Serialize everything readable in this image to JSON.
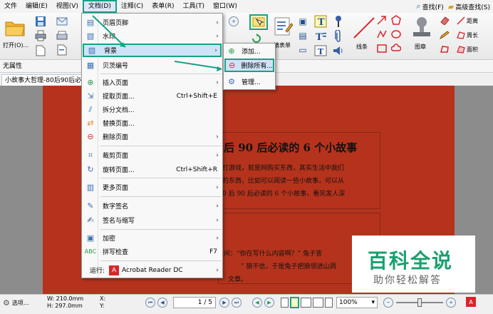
{
  "menubar": {
    "items": [
      "文件",
      "编辑(E)",
      "视图(V)",
      "文档(D)",
      "注释(C)",
      "表单(R)",
      "工具(T)",
      "窗口(W)"
    ],
    "search": "查找(F)",
    "advanced_search": "高级查找(S)"
  },
  "ribbon": {
    "open_label": "打开(O)...",
    "line_label": "线条",
    "stamp_label": "图章",
    "fill_form_label": "填表单",
    "distance_label": "距离",
    "perimeter_label": "周长",
    "area_label": "面积"
  },
  "propbar": {
    "label": "无属性"
  },
  "tab": {
    "label": "小故事大哲理-80后90后必读..."
  },
  "document": {
    "title": "后 90 后必读的 6 个小故事",
    "lines": [
      "打游戏，就是网购买东西，其实生活中我们",
      "的东西，比如可以阅读一些小故事，可以从",
      "0 后 90 后必读的 6 个小故事，看完发人深"
    ],
    "lines2": [
      "问：“你在写什么内容啊？” 兔子答",
      "” 狼不信，于是兔子把狼领进山洞",
      "文章。"
    ]
  },
  "watermark": {
    "title": "百科全说",
    "subtitle": "助你轻松解答"
  },
  "doc_menu": {
    "items": [
      {
        "label": "页眉页脚",
        "shortcut": "",
        "arrow": "›"
      },
      {
        "label": "水印",
        "shortcut": "",
        "arrow": "›"
      },
      {
        "label": "背景",
        "shortcut": "",
        "arrow": "›"
      },
      {
        "label": "贝茨编号",
        "shortcut": "",
        "arrow": ""
      },
      {
        "label": "插入页面",
        "shortcut": "",
        "arrow": "›"
      },
      {
        "label": "提取页面...",
        "shortcut": "Ctrl+Shift+E",
        "arrow": ""
      },
      {
        "label": "拆分文档...",
        "shortcut": "",
        "arrow": ""
      },
      {
        "label": "替换页面...",
        "shortcut": "",
        "arrow": ""
      },
      {
        "label": "删除页面",
        "shortcut": "",
        "arrow": "›"
      },
      {
        "label": "裁剪页面",
        "shortcut": "",
        "arrow": "›"
      },
      {
        "label": "旋转页面...",
        "shortcut": "Ctrl+Shift+R",
        "arrow": ""
      },
      {
        "label": "更多页面",
        "shortcut": "",
        "arrow": "›"
      },
      {
        "label": "数字签名",
        "shortcut": "",
        "arrow": "›"
      },
      {
        "label": "签名与缩写",
        "shortcut": "",
        "arrow": "›"
      },
      {
        "label": "加密",
        "shortcut": "",
        "arrow": "›"
      },
      {
        "label": "拼写检查",
        "shortcut": "F7",
        "arrow": ""
      },
      {
        "label": "运行:",
        "shortcut": "",
        "arrow": "›"
      }
    ],
    "run_app": "Acrobat Reader DC"
  },
  "background_submenu": {
    "items": [
      "添加...",
      "删除所有...",
      "管理..."
    ]
  },
  "statusbar": {
    "options": "选项...",
    "width": "W: 210.0mm",
    "height": "H: 297.0mm",
    "x": "X:",
    "y": "Y:",
    "page_value": "1 / 5",
    "zoom_value": "100%"
  },
  "colors": {
    "accent": "#19a185",
    "page_bg": "#b5331c",
    "menu_highlight": "#cfe3f8",
    "watermark_green": "#1aa06d"
  }
}
